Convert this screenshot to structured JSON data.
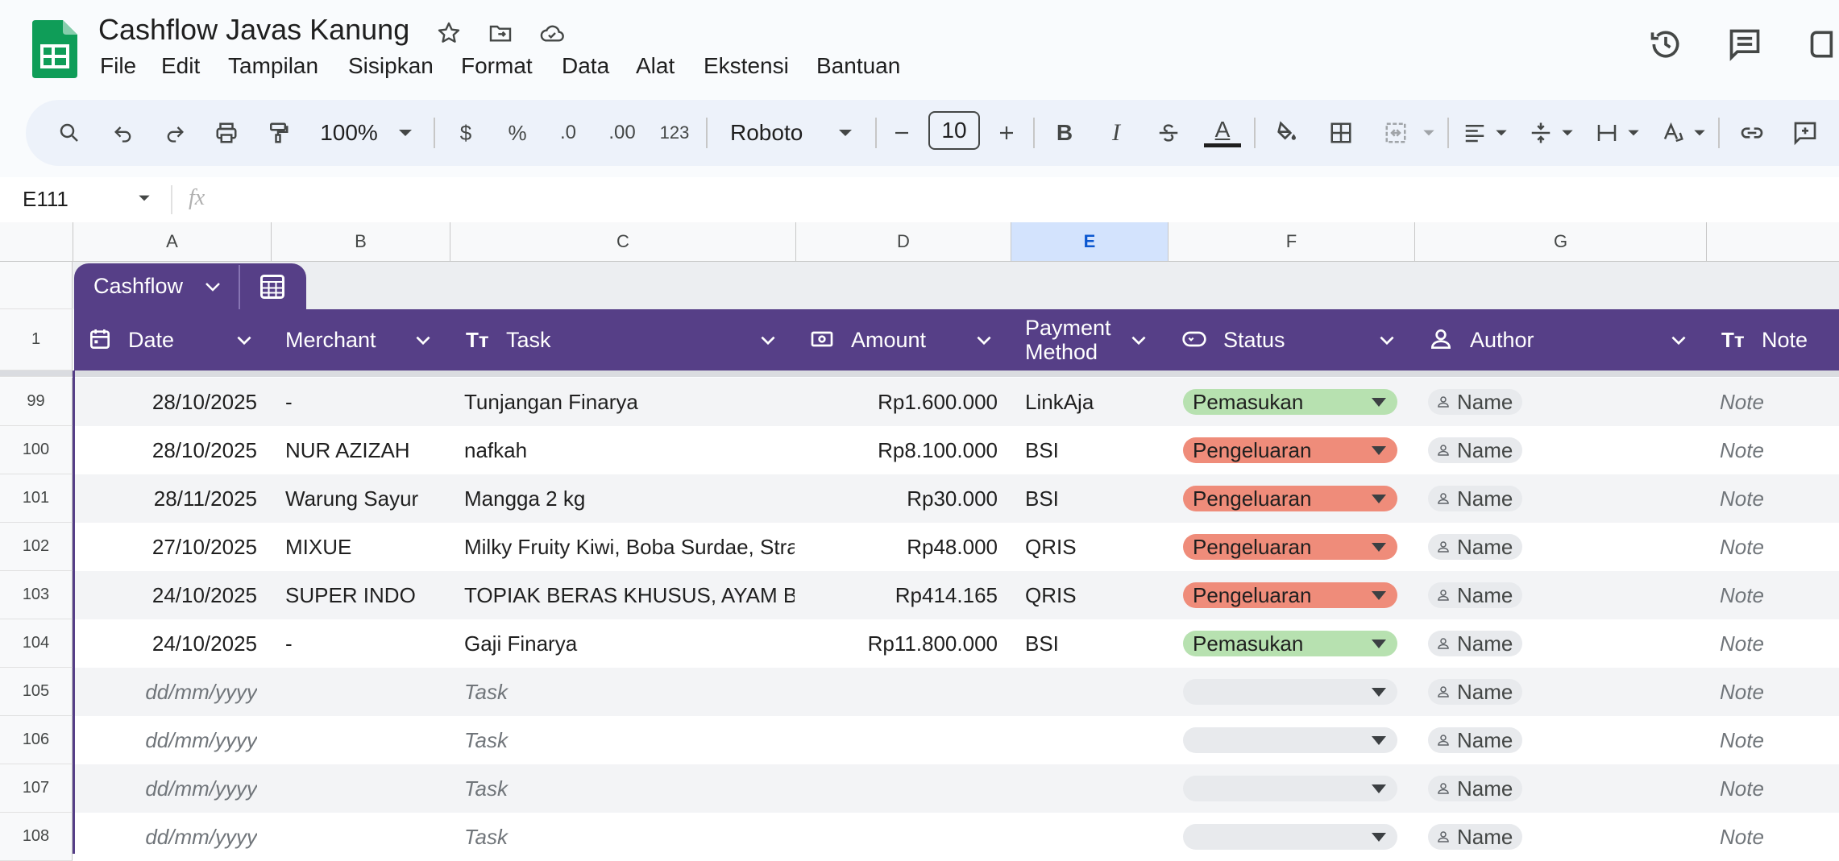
{
  "app": {
    "title": "Cashflow Javas Kanung",
    "menu": [
      "File",
      "Edit",
      "Tampilan",
      "Sisipkan",
      "Format",
      "Data",
      "Alat",
      "Ekstensi",
      "Bantuan"
    ]
  },
  "toolbar": {
    "zoom": "100%",
    "currency": "$",
    "percent": "%",
    "decrease_decimal": ".0",
    "increase_decimal": ".00",
    "number_format": "123",
    "font": "Roboto",
    "font_size": "10",
    "bold": "B",
    "italic": "I",
    "text_color": "A"
  },
  "formula_bar": {
    "name_box": "E111",
    "fx": "fx"
  },
  "columns": [
    "A",
    "B",
    "C",
    "D",
    "E",
    "F",
    "G"
  ],
  "selected_column": "E",
  "table": {
    "tab_name": "Cashflow",
    "headers": {
      "date": "Date",
      "merchant": "Merchant",
      "task": "Task",
      "amount": "Amount",
      "payment_method_line1": "Payment",
      "payment_method_line2": "Method",
      "status": "Status",
      "author": "Author",
      "note": "Note"
    },
    "header_row_number": "1",
    "rows": [
      {
        "num": "99",
        "date": "28/10/2025",
        "merchant": "-",
        "task": "Tunjangan Finarya",
        "amount": "Rp1.600.000",
        "method": "LinkAja",
        "status": "Pemasukan",
        "author": "Name",
        "note": "Note"
      },
      {
        "num": "100",
        "date": "28/10/2025",
        "merchant": "NUR AZIZAH",
        "task": "nafkah",
        "amount": "Rp8.100.000",
        "method": "BSI",
        "status": "Pengeluaran",
        "author": "Name",
        "note": "Note"
      },
      {
        "num": "101",
        "date": "28/11/2025",
        "merchant": "Warung Sayur",
        "task": "Mangga 2 kg",
        "amount": "Rp30.000",
        "method": "BSI",
        "status": "Pengeluaran",
        "author": "Name",
        "note": "Note"
      },
      {
        "num": "102",
        "date": "27/10/2025",
        "merchant": "MIXUE",
        "task": "Milky Fruity Kiwi, Boba Surdae, Stra",
        "amount": "Rp48.000",
        "method": "QRIS",
        "status": "Pengeluaran",
        "author": "Name",
        "note": "Note"
      },
      {
        "num": "103",
        "date": "24/10/2025",
        "merchant": "SUPER INDO",
        "task": "TOPIAK BERAS KHUSUS, AYAM BR",
        "amount": "Rp414.165",
        "method": "QRIS",
        "status": "Pengeluaran",
        "author": "Name",
        "note": "Note"
      },
      {
        "num": "104",
        "date": "24/10/2025",
        "merchant": "-",
        "task": "Gaji Finarya",
        "amount": "Rp11.800.000",
        "method": "BSI",
        "status": "Pemasukan",
        "author": "Name",
        "note": "Note"
      },
      {
        "num": "105",
        "date": "dd/mm/yyyy",
        "merchant": "",
        "task": "Task",
        "amount": "",
        "method": "",
        "status": "",
        "author": "Name",
        "note": "Note",
        "placeholder": true
      },
      {
        "num": "106",
        "date": "dd/mm/yyyy",
        "merchant": "",
        "task": "Task",
        "amount": "",
        "method": "",
        "status": "",
        "author": "Name",
        "note": "Note",
        "placeholder": true
      },
      {
        "num": "107",
        "date": "dd/mm/yyyy",
        "merchant": "",
        "task": "Task",
        "amount": "",
        "method": "",
        "status": "",
        "author": "Name",
        "note": "Note",
        "placeholder": true
      },
      {
        "num": "108",
        "date": "dd/mm/yyyy",
        "merchant": "",
        "task": "Task",
        "amount": "",
        "method": "",
        "status": "",
        "author": "Name",
        "note": "Note",
        "placeholder": true
      }
    ]
  },
  "colors": {
    "header_purple": "#563f87",
    "income_green": "#b7e1b0",
    "expense_red": "#ef8c7a",
    "empty_chip": "#e8eaed",
    "selected_col": "#d3e3fd"
  }
}
